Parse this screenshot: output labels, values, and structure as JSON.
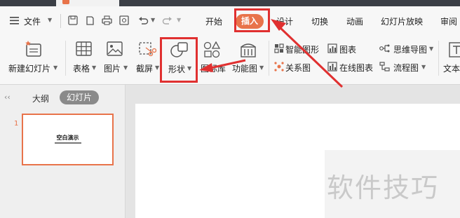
{
  "colors": {
    "accent": "#e8734a",
    "highlight": "#e03030"
  },
  "menu": {
    "file": "文件",
    "tabs": [
      "开始",
      "插入",
      "设计",
      "切换",
      "动画",
      "幻灯片放映",
      "审阅"
    ]
  },
  "ribbon": {
    "new_slide": "新建幻灯片",
    "table": "表格",
    "picture": "图片",
    "screenshot": "截屏",
    "shape": "形状",
    "icon_library": "图标库",
    "function_chart": "功能图",
    "smartart": "智能图形",
    "relation_chart": "关系图",
    "chart": "图表",
    "online_chart": "在线图表",
    "mindmap": "思维导图",
    "flowchart": "流程图",
    "text": "文本"
  },
  "panel": {
    "outline": "大纲",
    "slides": "幻灯片",
    "slide_number": "1",
    "thumb_title": "空白演示"
  },
  "watermark": "软件技巧"
}
